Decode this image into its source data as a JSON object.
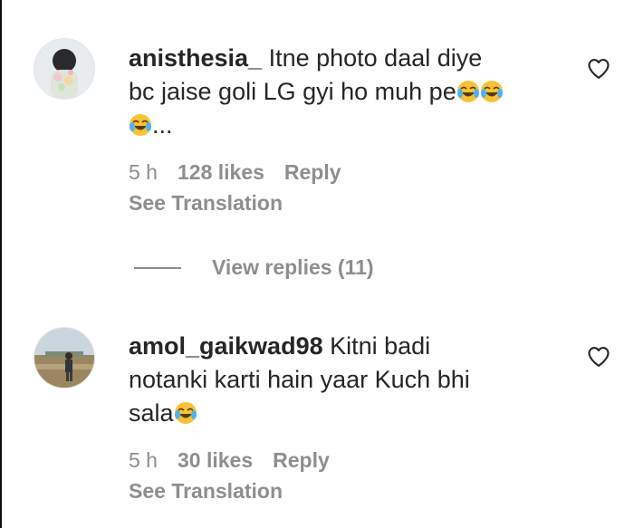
{
  "comments": [
    {
      "username": "anisthesia_",
      "text_line1": " Itne photo daal diye",
      "text_line2": "bc jaise goli LG gyi ho muh pe",
      "text_line3_suffix": "...",
      "time": "5 h",
      "likes": "128 likes",
      "reply": "Reply",
      "see_translation": "See Translation",
      "view_replies": "View replies (11)"
    },
    {
      "username": "amol_gaikwad98",
      "text_line1": " Kitni badi",
      "text_line2": "notanki karti hain yaar Kuch bhi",
      "text_line3": "sala",
      "time": "5 h",
      "likes": "30 likes",
      "reply": "Reply",
      "see_translation": "See Translation"
    }
  ],
  "icons": {
    "like": "heart-outline-icon",
    "emoji": "face-with-tears-of-joy-emoji"
  },
  "colors": {
    "text": "#262626",
    "secondary": "#8e8e8e",
    "background": "#ffffff"
  }
}
